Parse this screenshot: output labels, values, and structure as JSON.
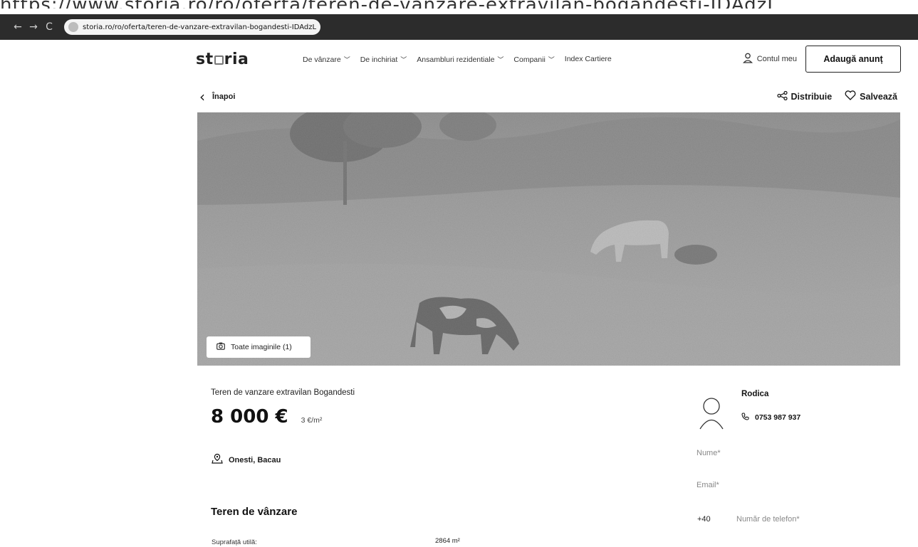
{
  "page_url_fragment": "https://www.storia.ro/ro/oferta/teren-de-vanzare-extravilan-bogandesti-IDAdzL",
  "browser": {
    "back": "←",
    "forward": "→",
    "reload": "C",
    "url": "storia.ro/ro/oferta/teren-de-vanzare-extravilan-bogandesti-IDAdzL"
  },
  "header": {
    "logo_left": "st",
    "logo_right": "ria",
    "menu": [
      {
        "label": "De vânzare",
        "chevron": "﹀"
      },
      {
        "label": "De inchiriat",
        "chevron": "﹀"
      },
      {
        "label": "Ansambluri rezidentiale",
        "chevron": "﹀"
      },
      {
        "label": "Companii",
        "chevron": "﹀"
      },
      {
        "label": "Index Cartiere",
        "chevron": ""
      }
    ],
    "account_label": "Contul meu",
    "add_listing_label": "Adaugă anunț"
  },
  "subbar": {
    "back_label": "Înapoi",
    "share_label": "Distribuie",
    "save_label": "Salvează"
  },
  "gallery": {
    "all_images_label": "Toate imaginile (1)"
  },
  "listing": {
    "title": "Teren de vanzare extravilan Bogandesti",
    "price": "8 000 €",
    "price_per_m2": "3 €/m²",
    "location": "Onesti, Bacau",
    "section_title": "Teren de vânzare",
    "details": [
      {
        "label": "Suprafață utilă:",
        "value": "2864 m²"
      }
    ]
  },
  "contact": {
    "agent_name": "Rodica",
    "agent_phone": "0753 987 937",
    "name_placeholder": "Nume*",
    "email_placeholder": "Email*",
    "phone_prefix": "+40",
    "phone_placeholder": "Număr de telefon*"
  },
  "icons": {
    "user": "user-icon",
    "share": "share-icon",
    "heart": "heart-icon",
    "camera": "camera-icon",
    "pin": "location-pin-icon",
    "phone": "phone-icon"
  }
}
